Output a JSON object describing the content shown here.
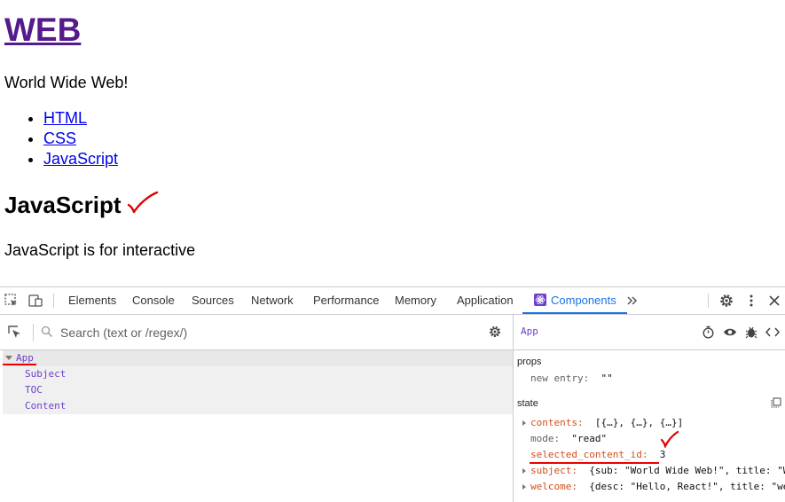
{
  "page": {
    "heading": "WEB",
    "heading_desc": "World Wide Web!",
    "toc": [
      "HTML",
      "CSS",
      "JavaScript"
    ],
    "article_title": "JavaScript",
    "article_desc": "JavaScript is for interactive"
  },
  "devtools": {
    "tabs": [
      "Elements",
      "Console",
      "Sources",
      "Network",
      "Performance",
      "Memory",
      "Application",
      "Components"
    ],
    "active_tab": "Components",
    "more_tabs_label": "»",
    "search_placeholder": "Search (text or /regex/)",
    "tree": {
      "root": "App",
      "children": [
        "Subject",
        "TOC",
        "Content"
      ]
    },
    "inspector": {
      "component": "App",
      "props_label": "props",
      "props": [
        {
          "key": "new entry",
          "value": "\"\""
        }
      ],
      "state_label": "state",
      "state": [
        {
          "key": "contents",
          "value": "[{…}, {…}, {…}]",
          "expandable": true
        },
        {
          "key": "mode",
          "value": "\"read\"",
          "expandable": false
        },
        {
          "key": "selected_content_id",
          "value": "3",
          "expandable": false
        },
        {
          "key": "subject",
          "value": "{sub: \"World Wide Web!\", title: \"WEB\"}",
          "expandable": true
        },
        {
          "key": "welcome",
          "value": "{desc: \"Hello, React!\", title: \"welco…",
          "expandable": true
        }
      ]
    }
  },
  "colors": {
    "link": "#0000ee",
    "visited": "#551a8b",
    "accent": "#1a73e8",
    "annotation": "#e00000",
    "component": "#6e40c9"
  }
}
